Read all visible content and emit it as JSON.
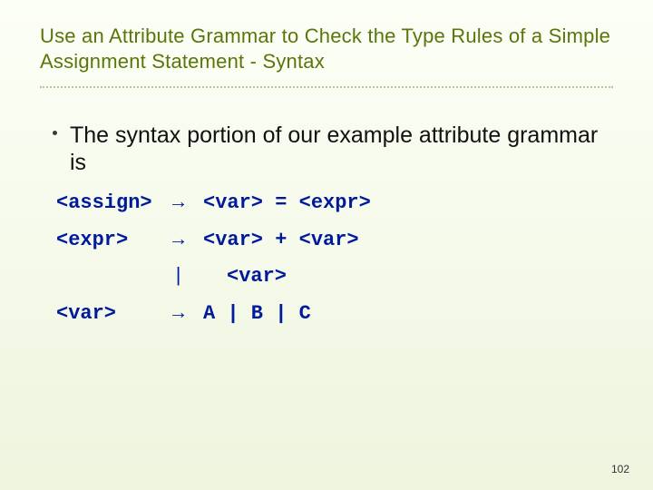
{
  "title": "Use an Attribute Grammar to Check the Type Rules of a Simple Assignment Statement - Syntax",
  "bullet_text": "The syntax portion of our example attribute grammar is",
  "grammar": {
    "rows": [
      {
        "lhs": "<assign>",
        "arrow": "→",
        "rhs": "<var> = <expr>"
      },
      {
        "lhs": "<expr>",
        "arrow": "→",
        "rhs": "<var> + <var>"
      },
      {
        "lhs": "",
        "arrow": "|",
        "rhs": "<var>",
        "pipe": true
      },
      {
        "lhs": "<var>",
        "arrow": "→",
        "rhs": "A | B | C"
      }
    ]
  },
  "page_number": "102"
}
